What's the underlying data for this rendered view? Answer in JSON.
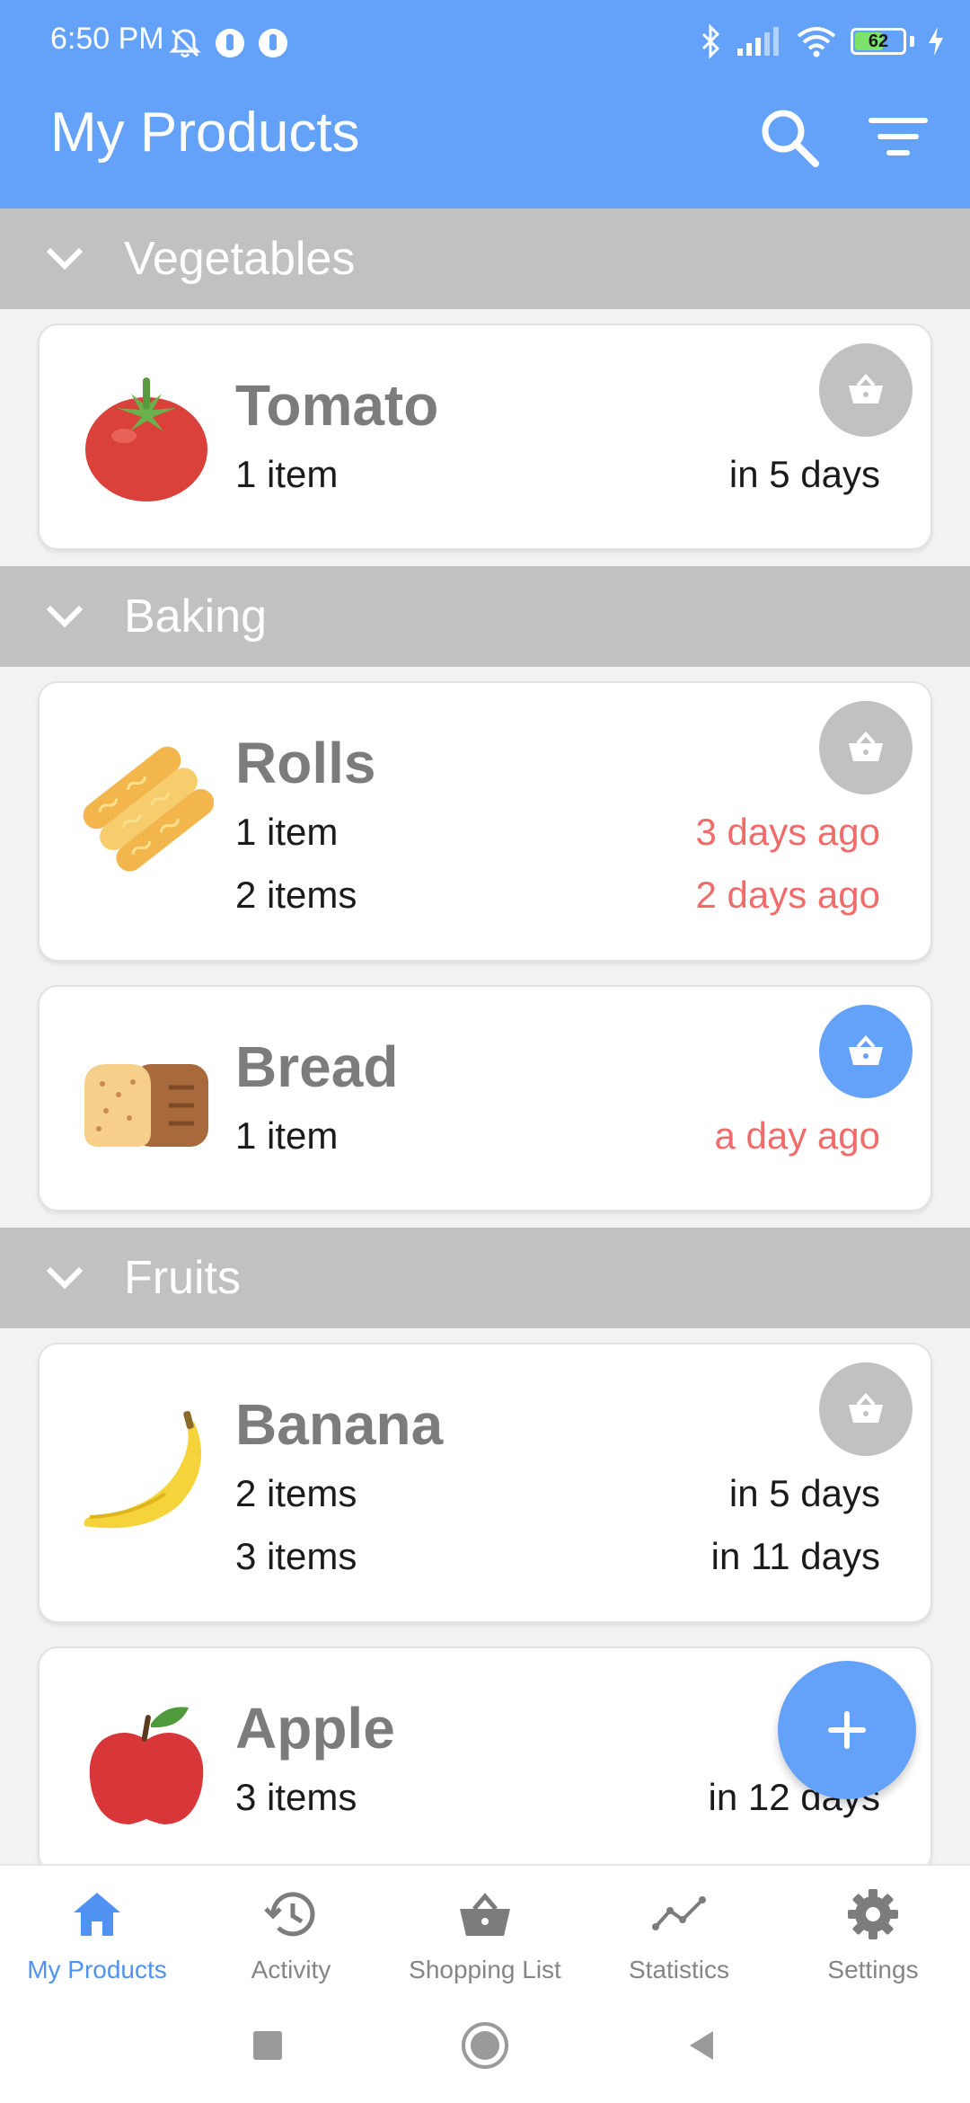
{
  "status_bar": {
    "time": "6:50 PM",
    "battery_level": "62",
    "battery_fraction": 0.62
  },
  "header": {
    "title": "My Products",
    "search_icon": "search-icon",
    "filter_icon": "filter-icon"
  },
  "categories": [
    {
      "label": "Vegetables",
      "products": [
        {
          "name": "Tomato",
          "icon": "tomato-icon",
          "rows": [
            {
              "qty": "1 item",
              "when": "in 5 days",
              "expired": false
            }
          ],
          "in_cart": false
        }
      ]
    },
    {
      "label": "Baking",
      "products": [
        {
          "name": "Rolls",
          "icon": "rolls-icon",
          "rows": [
            {
              "qty": "1 item",
              "when": "3 days ago",
              "expired": true
            },
            {
              "qty": "2 items",
              "when": "2 days ago",
              "expired": true
            }
          ],
          "in_cart": false
        },
        {
          "name": "Bread",
          "icon": "bread-icon",
          "rows": [
            {
              "qty": "1 item",
              "when": "a day ago",
              "expired": true
            }
          ],
          "in_cart": true
        }
      ]
    },
    {
      "label": "Fruits",
      "products": [
        {
          "name": "Banana",
          "icon": "banana-icon",
          "rows": [
            {
              "qty": "2 items",
              "when": "in 5 days",
              "expired": false
            },
            {
              "qty": "3 items",
              "when": "in 11 days",
              "expired": false
            }
          ],
          "in_cart": false
        },
        {
          "name": "Apple",
          "icon": "apple-icon",
          "rows": [
            {
              "qty": "3 items",
              "when": "in 12 days",
              "expired": false
            }
          ],
          "in_cart": false
        }
      ]
    }
  ],
  "fab": {
    "icon": "plus-icon"
  },
  "bottom_nav": [
    {
      "label": "My Products",
      "icon": "home-icon",
      "active": true
    },
    {
      "label": "Activity",
      "icon": "history-icon",
      "active": false
    },
    {
      "label": "Shopping List",
      "icon": "basket-icon",
      "active": false
    },
    {
      "label": "Statistics",
      "icon": "statistics-icon",
      "active": false
    },
    {
      "label": "Settings",
      "icon": "gear-icon",
      "active": false
    }
  ],
  "colors": {
    "primary": "#64a2f9",
    "category_bg": "#c1c1c1",
    "expired_text": "#f26b6b",
    "name_text": "#7c7c7c"
  }
}
